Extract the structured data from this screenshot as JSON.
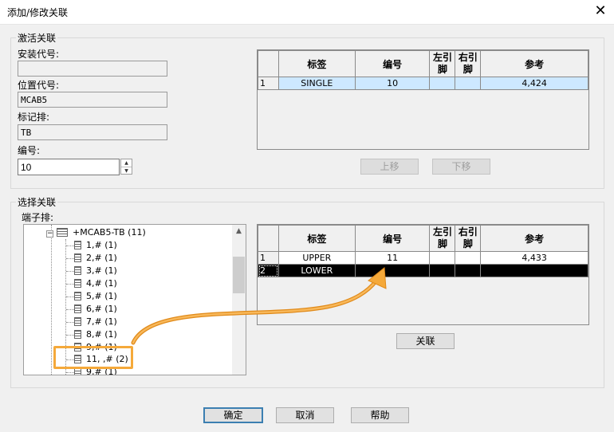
{
  "window": {
    "title": "添加/修改关联",
    "close_glyph": "✕"
  },
  "activate_group": {
    "label": "激活关联",
    "install_code_label": "安装代号:",
    "install_code_value": "",
    "location_code_label": "位置代号:",
    "location_code_value": "MCAB5",
    "marker_row_label": "标记排:",
    "marker_row_value": "TB",
    "number_label": "编号:",
    "number_value": "10",
    "grid": {
      "columns": [
        "标签",
        "编号",
        "左引脚",
        "右引脚",
        "参考"
      ],
      "rows": [
        {
          "index": "1",
          "cells": [
            "SINGLE",
            "10",
            "",
            "",
            "4,424"
          ]
        }
      ]
    },
    "move_up_label": "上移",
    "move_down_label": "下移"
  },
  "select_group": {
    "label": "选择关联",
    "terminal_strip_label": "端子排:",
    "tree": {
      "root": "+MCAB5-TB (11)",
      "items": [
        "1,# (1)",
        "2,# (1)",
        "3,# (1)",
        "4,# (1)",
        "5,# (1)",
        "6,# (1)",
        "7,# (1)",
        "8,# (1)",
        "9,# (1)",
        "11, ,# (2)",
        "9,# (1)"
      ]
    },
    "grid": {
      "columns": [
        "标签",
        "编号",
        "左引脚",
        "右引脚",
        "参考"
      ],
      "rows": [
        {
          "index": "1",
          "cells": [
            "UPPER",
            "11",
            "",
            "",
            "4,433"
          ]
        },
        {
          "index": "2",
          "cells": [
            "LOWER",
            "",
            "",
            "",
            ""
          ]
        }
      ]
    },
    "associate_label": "关联"
  },
  "footer": {
    "ok_label": "确定",
    "cancel_label": "取消",
    "help_label": "帮助"
  },
  "colors": {
    "highlight_orange": "#f5a93a",
    "selection_blue": "#cde8ff",
    "default_button_border": "#3c7fb1"
  }
}
